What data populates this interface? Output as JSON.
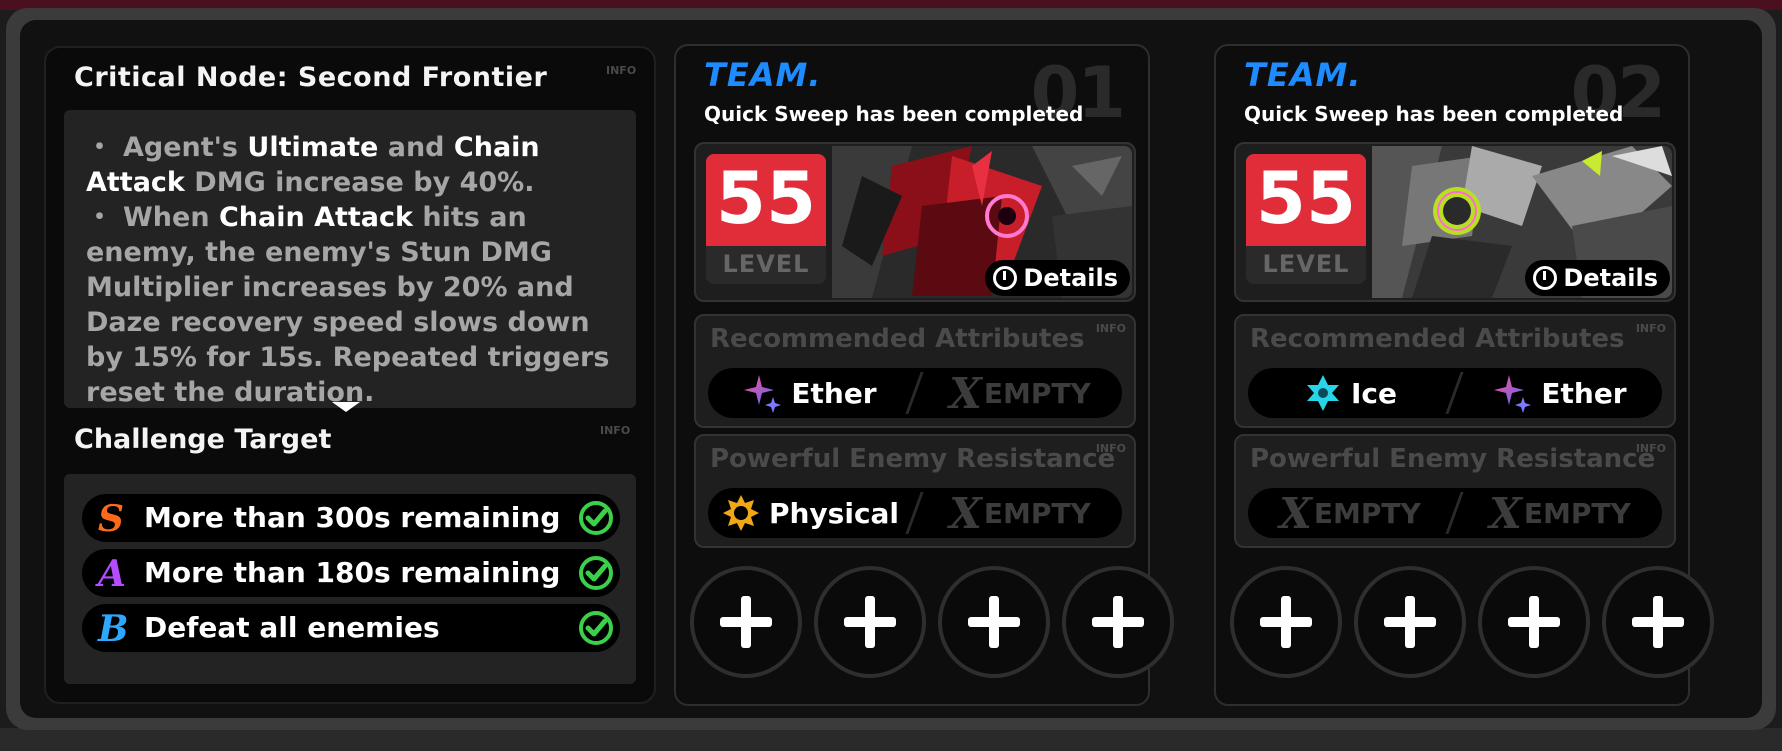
{
  "info_label": "INFO",
  "critical_node": {
    "title": "Critical Node: Second Frontier",
    "effects": [
      {
        "bullet": "・",
        "parts": [
          {
            "text": "Agent's ",
            "highlight": false
          },
          {
            "text": "Ultimate",
            "highlight": true
          },
          {
            "text": " and ",
            "highlight": false
          },
          {
            "text": "Chain Attack",
            "highlight": true
          },
          {
            "text": " DMG increase by 40%.",
            "highlight": false
          }
        ]
      },
      {
        "bullet": "・",
        "parts": [
          {
            "text": "When ",
            "highlight": false
          },
          {
            "text": "Chain Attack",
            "highlight": true
          },
          {
            "text": " hits an enemy, the enemy's Stun DMG Multiplier increases by 20% and Daze recovery speed slows down by 15% for 15s. Repeated triggers reset the duration.",
            "highlight": false
          }
        ]
      }
    ]
  },
  "challenge": {
    "title": "Challenge Target",
    "targets": [
      {
        "rank": "S",
        "rank_color": "#ff6a1a",
        "text": "More than 300s remaining",
        "completed": true
      },
      {
        "rank": "A",
        "rank_color": "#b44dff",
        "text": "More than 180s remaining",
        "completed": true
      },
      {
        "rank": "B",
        "rank_color": "#2ea8ff",
        "text": "Defeat all enemies",
        "completed": true
      }
    ]
  },
  "teams": [
    {
      "label": "TEAM.",
      "number": "01",
      "status": "Quick Sweep has been completed",
      "level": "55",
      "level_label": "LEVEL",
      "details_label": "Details",
      "art_theme": "red",
      "recommended_title": "Recommended Attributes",
      "recommended": [
        {
          "name": "Ether",
          "icon": "ether-icon",
          "empty": false
        },
        {
          "name": "EMPTY",
          "icon": "empty-x-icon",
          "empty": true
        }
      ],
      "resistance_title": "Powerful Enemy Resistance",
      "resistance": [
        {
          "name": "Physical",
          "icon": "physical-icon",
          "empty": false
        },
        {
          "name": "EMPTY",
          "icon": "empty-x-icon",
          "empty": true
        }
      ],
      "slots": [
        "add-agent",
        "add-agent",
        "add-agent",
        "add-agent"
      ]
    },
    {
      "label": "TEAM.",
      "number": "02",
      "status": "Quick Sweep has been completed",
      "level": "55",
      "level_label": "LEVEL",
      "details_label": "Details",
      "art_theme": "green",
      "recommended_title": "Recommended Attributes",
      "recommended": [
        {
          "name": "Ice",
          "icon": "ice-icon",
          "empty": false
        },
        {
          "name": "Ether",
          "icon": "ether-icon",
          "empty": false
        }
      ],
      "resistance_title": "Powerful Enemy Resistance",
      "resistance": [
        {
          "name": "EMPTY",
          "icon": "empty-x-icon",
          "empty": true
        },
        {
          "name": "EMPTY",
          "icon": "empty-x-icon",
          "empty": true
        }
      ],
      "slots": [
        "add-agent",
        "add-agent",
        "add-agent",
        "add-agent"
      ]
    }
  ],
  "colors": {
    "team_blue": "#1e8cff",
    "level_red": "#e12d39",
    "check_green": "#3cd04a"
  }
}
